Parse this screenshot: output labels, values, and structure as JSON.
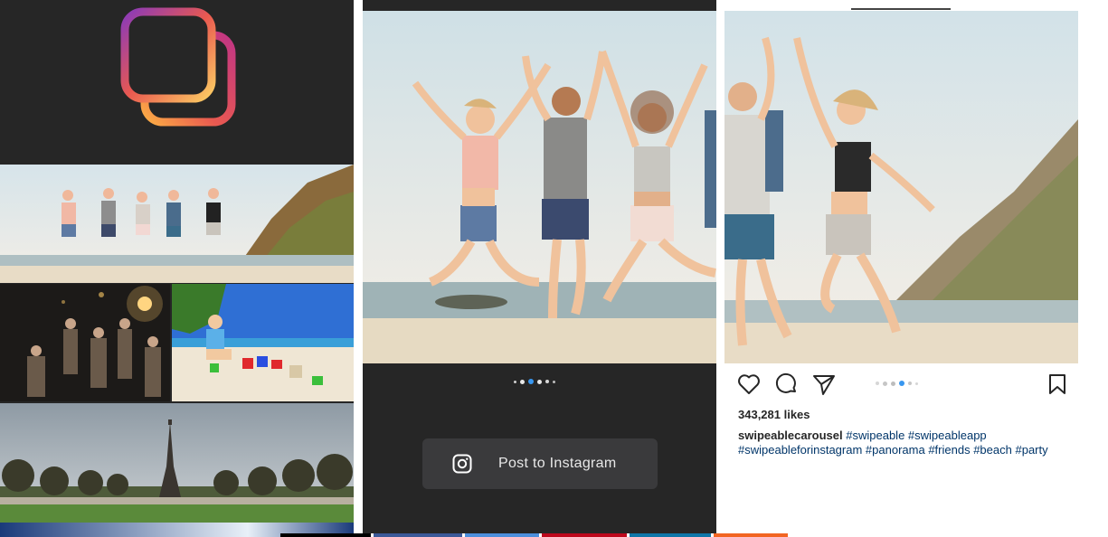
{
  "panel_feed": {
    "logo_icon": "carousel-stack-icon",
    "logo_colors": [
      "#8a3ab9",
      "#e95950",
      "#fccc63"
    ],
    "photos": [
      "beach-jump-photo",
      "night-party-photo",
      "kid-sandcastle-photo",
      "eiffel-tower-photo"
    ]
  },
  "panel_preview": {
    "photo": "beach-jump-photo",
    "dot_count": 6,
    "active_dot": 2,
    "post_button": {
      "label": "Post to Instagram",
      "icon": "instagram-icon"
    }
  },
  "panel_post": {
    "photo": "beach-jump-photo",
    "icons": [
      "heart-icon",
      "comment-icon",
      "send-icon",
      "bookmark-icon"
    ],
    "dot_count": 6,
    "active_dot": 3,
    "likes": "343,281 likes",
    "caption": {
      "username": "swipeablecarousel",
      "hashtags": [
        "#swipeable",
        "#swipeableapp",
        "#swipeableforinstagram",
        "#panorama",
        "#friends",
        "#beach",
        "#party"
      ]
    }
  },
  "colors": {
    "dark_bg": "#262626",
    "button_bg": "#3a3a3c",
    "active_dot": "#3897f0",
    "hashtag": "#003569"
  },
  "share_strip_colors": [
    "#000000",
    "#3b5998",
    "#4c8fdc",
    "#bd081c",
    "#0e76a8",
    "#f26522"
  ]
}
